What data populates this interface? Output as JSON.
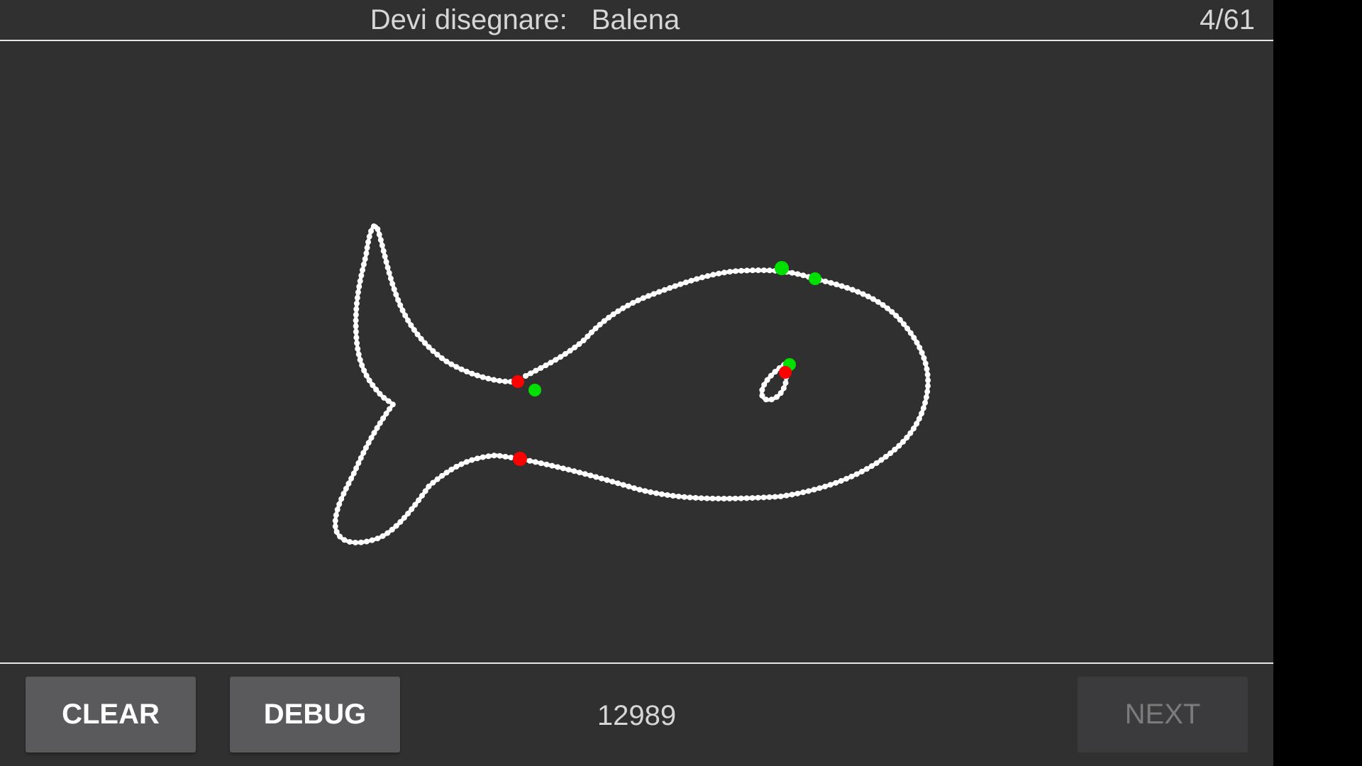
{
  "header": {
    "prompt_label": "Devi disegnare:",
    "target_word": "Balena",
    "progress": "4/61"
  },
  "footer": {
    "clear_label": "CLEAR",
    "debug_label": "DEBUG",
    "score": "12989",
    "next_label": "NEXT",
    "next_enabled": false
  },
  "canvas": {
    "background": "#303030",
    "stroke_color": "#ffffff",
    "start_marker_color": "#00e000",
    "end_marker_color": "#ff0000"
  },
  "colors": {
    "app_background": "#303030",
    "text": "#d6d6d6",
    "button": "#5a5a5c",
    "button_disabled": "#3b3b3d",
    "divider": "#e6e6e6"
  }
}
